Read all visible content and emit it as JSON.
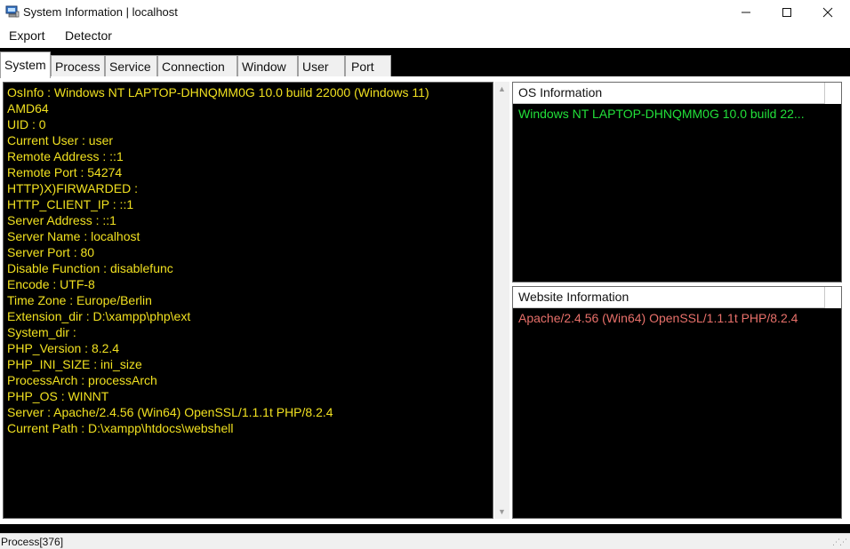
{
  "window": {
    "title": "System Information | localhost",
    "controls": {
      "minimize": "—",
      "maximize": "☐",
      "close": "✕"
    }
  },
  "menu": {
    "items": [
      "Export",
      "Detector"
    ]
  },
  "tabs": {
    "active": "System",
    "items": [
      "System",
      "Process",
      "Service",
      "Connection",
      "Window",
      "User",
      "Port"
    ]
  },
  "system_info": {
    "lines": [
      "OsInfo : Windows NT LAPTOP-DHNQMM0G 10.0 build 22000 (Windows 11)",
      "AMD64",
      "UID : 0",
      "Current User : user",
      "Remote Address : ::1",
      "Remote Port : 54274",
      "HTTP)X)FIRWARDED :",
      "HTTP_CLIENT_IP : ::1",
      "Server Address : ::1",
      "Server Name : localhost",
      "Server Port : 80",
      "Disable Function : disablefunc",
      "Encode : UTF-8",
      "Time Zone : Europe/Berlin",
      "Extension_dir : D:\\xampp\\php\\ext",
      "System_dir :",
      "PHP_Version : 8.2.4",
      "PHP_INI_SIZE : ini_size",
      "ProcessArch : processArch",
      "PHP_OS : WINNT",
      "Server : Apache/2.4.56 (Win64) OpenSSL/1.1.1t PHP/8.2.4",
      "Current Path : D:\\xampp\\htdocs\\webshell"
    ],
    "text_color": "#f0e020"
  },
  "os_information": {
    "header": "OS Information",
    "value": "Windows NT LAPTOP-DHNQMM0G 10.0 build 22...",
    "text_color": "#22e03a"
  },
  "website_information": {
    "header": "Website Information",
    "value": "Apache/2.4.56 (Win64) OpenSSL/1.1.1t PHP/8.2.4",
    "text_color": "#e8706a"
  },
  "status": {
    "text": "Process[376]"
  },
  "icons": {
    "app": "computer-icon",
    "scroll_up": "chevron-up-icon",
    "scroll_down": "chevron-down-icon",
    "grip": "resize-grip-icon"
  }
}
